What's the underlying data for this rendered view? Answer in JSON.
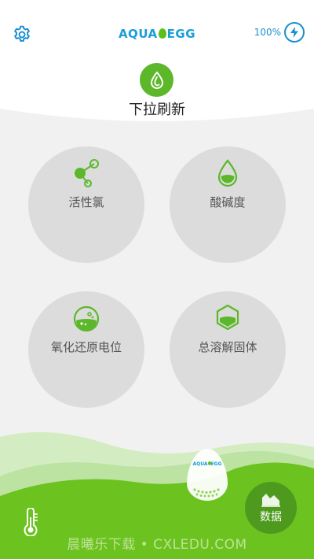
{
  "header": {
    "logo_left": "AQUA",
    "logo_right": "EGG",
    "battery_percent": "100%"
  },
  "refresh": {
    "label": "下拉刷新"
  },
  "metrics": [
    {
      "label": "活性氯",
      "icon": "molecule-icon"
    },
    {
      "label": "酸碱度",
      "icon": "ph-drop-icon"
    },
    {
      "label": "氧化还原电位",
      "icon": "flask-icon"
    },
    {
      "label": "总溶解固体",
      "icon": "hexagon-icon"
    }
  ],
  "device": {
    "logo_left": "AQUA",
    "logo_right": "EGG"
  },
  "footer": {
    "data_label": "数据",
    "watermark": "晨曦乐下载 • CXLEDU.COM"
  },
  "colors": {
    "accent_green": "#5cb82a",
    "accent_blue": "#1a8fd0",
    "circle_bg": "#dcdcdc"
  }
}
